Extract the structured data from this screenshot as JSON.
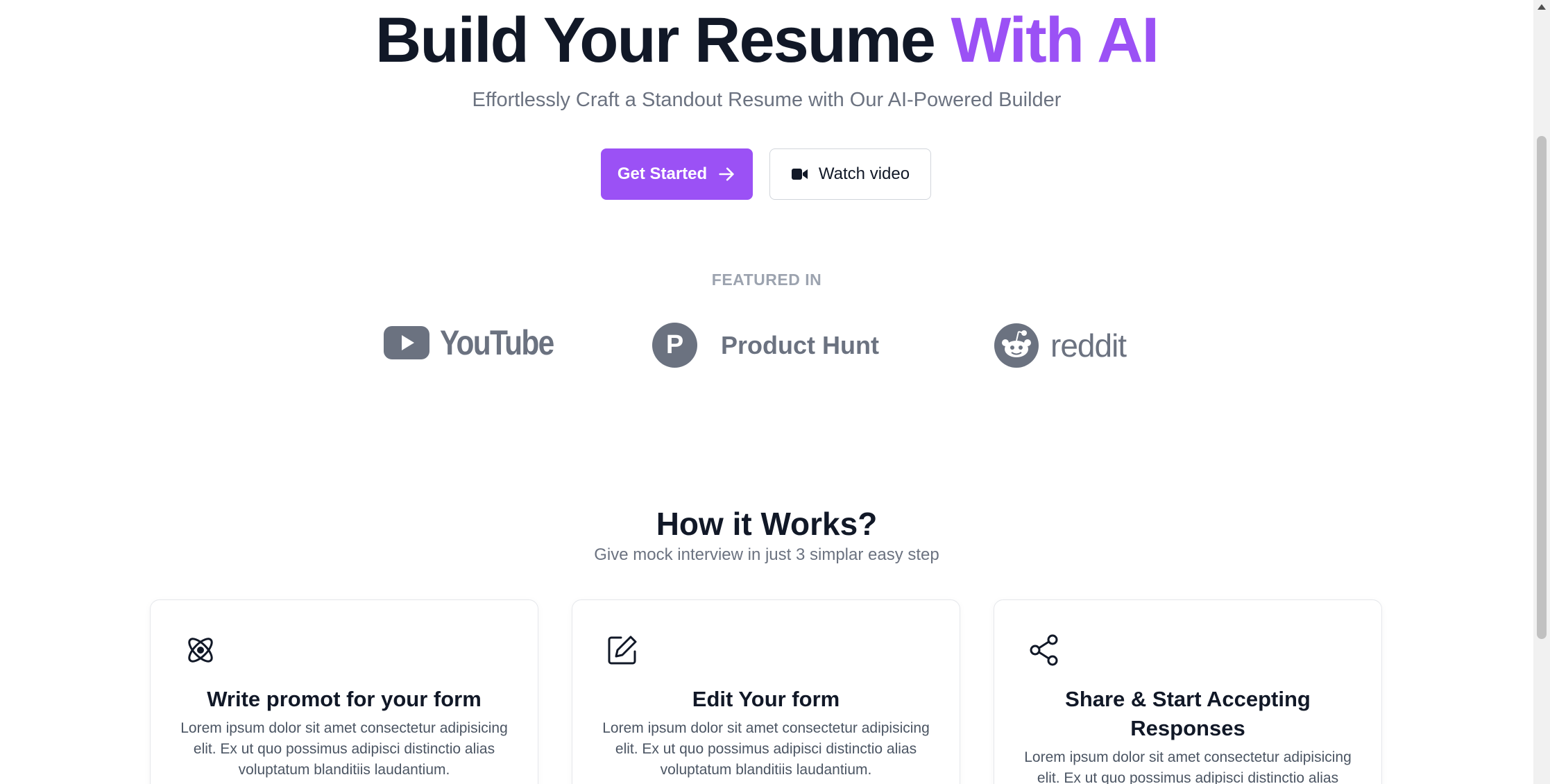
{
  "hero": {
    "title_main": "Build Your Resume",
    "title_accent": "With AI",
    "subtitle": "Effortlessly Craft a Standout Resume with Our AI-Powered Builder",
    "primary_button": "Get Started",
    "secondary_button": "Watch video"
  },
  "featured": {
    "label": "FEATURED IN",
    "logos": [
      {
        "name": "YouTube",
        "icon": "youtube-play-icon"
      },
      {
        "name": "Product Hunt",
        "icon": "product-hunt-icon",
        "letter": "P"
      },
      {
        "name": "reddit",
        "icon": "reddit-alien-icon"
      }
    ]
  },
  "how_it_works": {
    "title": "How it Works?",
    "subtitle": "Give mock interview in just 3 simplar easy step",
    "steps": [
      {
        "icon": "atom-icon",
        "title": "Write promot for your form",
        "description": "Lorem ipsum dolor sit amet consectetur adipisicing elit. Ex ut quo possimus adipisci distinctio alias voluptatum blanditiis laudantium."
      },
      {
        "icon": "edit-icon",
        "title": "Edit Your form",
        "description": "Lorem ipsum dolor sit amet consectetur adipisicing elit. Ex ut quo possimus adipisci distinctio alias voluptatum blanditiis laudantium."
      },
      {
        "icon": "share-icon",
        "title": "Share & Start Accepting Responses",
        "description": "Lorem ipsum dolor sit amet consectetur adipisicing elit. Ex ut quo possimus adipisci distinctio alias voluptatum blanditiis laudantium."
      }
    ]
  },
  "colors": {
    "accent": "#9b51f5",
    "text_dark": "#111827",
    "text_muted": "#6b7280",
    "logo_gray": "#6b7280"
  }
}
